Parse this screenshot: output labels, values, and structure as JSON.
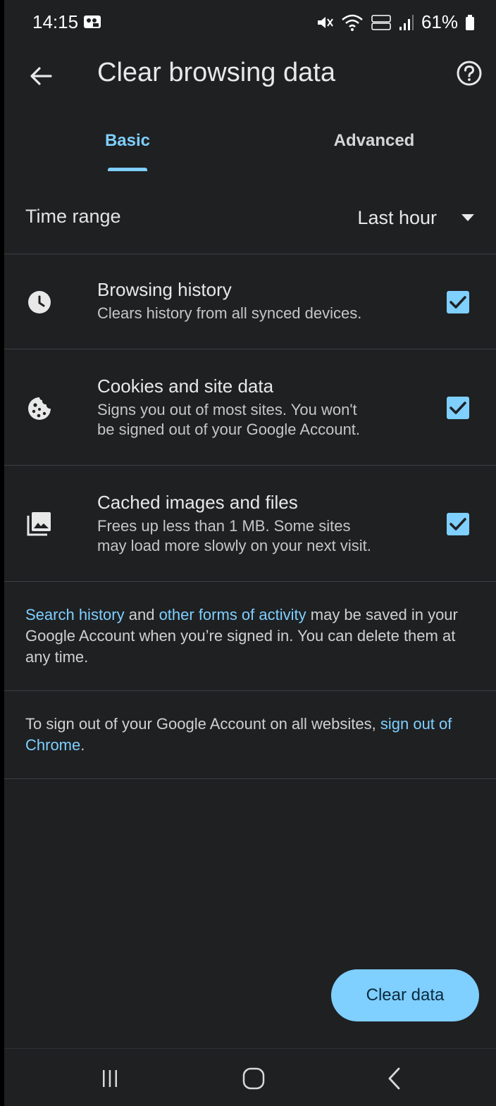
{
  "status_bar": {
    "time": "14:15",
    "battery": "61%"
  },
  "app_bar": {
    "title": "Clear browsing data"
  },
  "tabs": [
    {
      "label": "Basic",
      "selected": true
    },
    {
      "label": "Advanced",
      "selected": false
    }
  ],
  "time_range": {
    "label": "Time range",
    "value": "Last hour"
  },
  "options": [
    {
      "title": "Browsing history",
      "desc_line1": "Clears history from all synced devices.",
      "desc_line2": "",
      "icon": "clock-icon",
      "checked": true
    },
    {
      "title": "Cookies and site data",
      "desc_line1": "Signs you out of most sites. You won't",
      "desc_line2": "be signed out of your Google Account.",
      "icon": "cookie-icon",
      "checked": true
    },
    {
      "title": "Cached images and files",
      "desc_line1": "Frees up less than 1 MB. Some sites",
      "desc_line2": "may load more slowly on your next visit.",
      "icon": "image-icon",
      "checked": true
    }
  ],
  "info1": {
    "link1": "Search history",
    "text1": " and ",
    "link2": "other forms of activity",
    "text2": " may be saved in your Google Account when you’re signed in. You can delete them at any time."
  },
  "info2": {
    "text1": "To sign out of your Google Account on all websites, ",
    "link": "sign out of Chrome",
    "text2": "."
  },
  "clear_button": {
    "label": "Clear data"
  },
  "colors": {
    "accent": "#7fcfff",
    "background": "#1e2022",
    "divider": "#3c3f43"
  }
}
